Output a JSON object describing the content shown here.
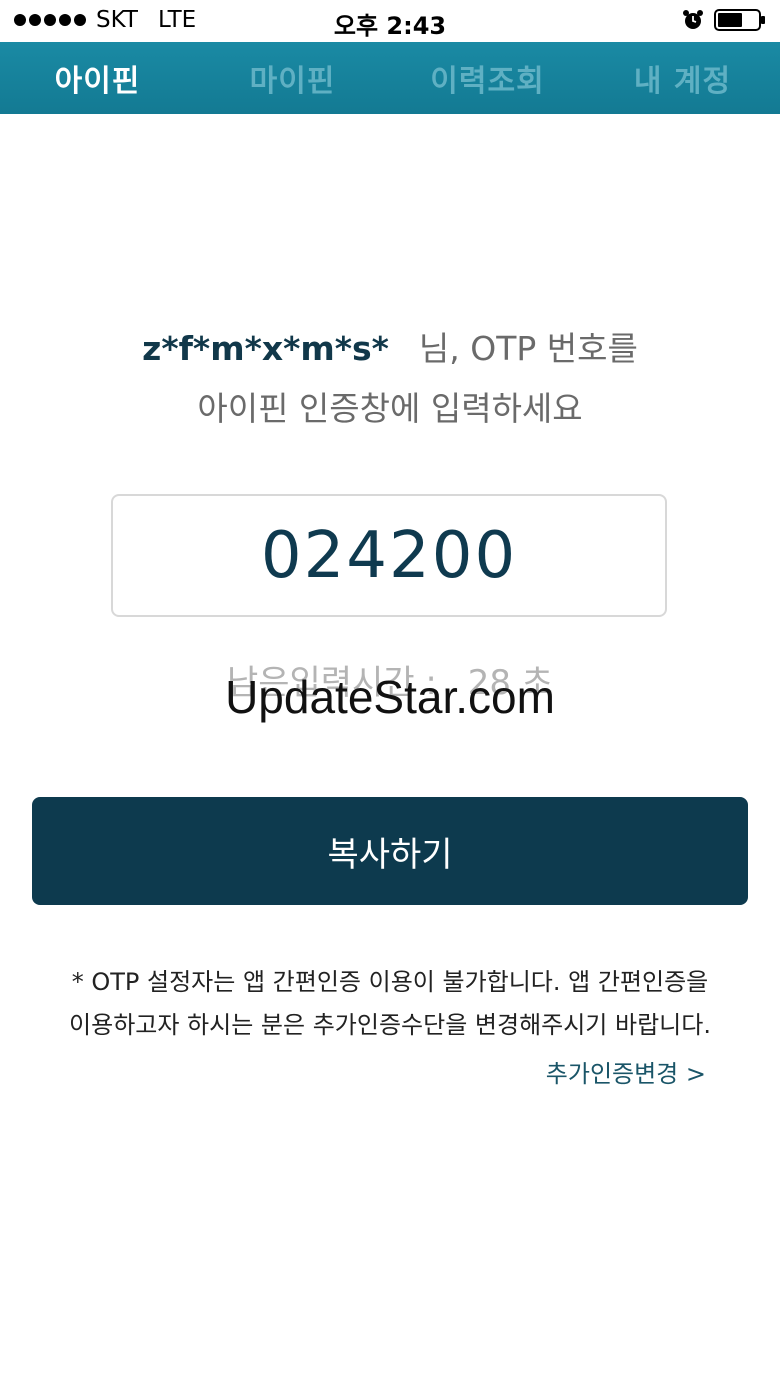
{
  "status_bar": {
    "carrier": "SKT",
    "network": "LTE",
    "time": "오후 2:43",
    "icons": [
      "signal-dots",
      "alarm-icon",
      "battery-icon"
    ]
  },
  "tabs": [
    {
      "label": "아이핀",
      "active": true
    },
    {
      "label": "마이핀",
      "active": false
    },
    {
      "label": "이력조회",
      "active": false
    },
    {
      "label": "내 계정",
      "active": false
    }
  ],
  "message": {
    "user": "z*f*m*x*m*s*",
    "line1_suffix": "님, OTP 번호를",
    "line2": "아이핀 인증창에 입력하세요"
  },
  "otp": {
    "value": "024200"
  },
  "timer": {
    "label": "남은입력시간 :",
    "seconds": "28",
    "unit": "초"
  },
  "watermark": "UpdateStar.com",
  "copy_button": {
    "label": "복사하기"
  },
  "notice": {
    "line1": "* OTP 설정자는 앱 간편인증 이용이 불가합니다. 앱 간편인증을",
    "line2": "이용하고자 하시는 분은 추가인증수단을 변경해주시기 바랍니다."
  },
  "change_link": {
    "label": "추가인증변경 >"
  },
  "colors": {
    "tab_bar": "#137a93",
    "tab_active": "#ffffff",
    "tab_inactive": "#5fb0c3",
    "primary_dark": "#0d3a4e"
  }
}
